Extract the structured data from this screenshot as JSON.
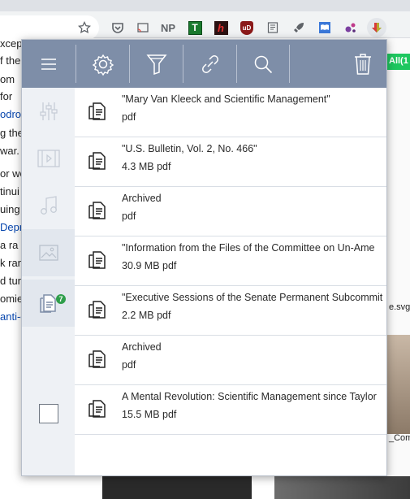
{
  "toolbar": {
    "ext_np_label": "NP",
    "ext_t_label": "T",
    "ext_h_label": "h",
    "ext_ub_label": "uD"
  },
  "background_page": {
    "left_fragments": [
      "xcep",
      "f the",
      "om",
      "for",
      "odro",
      "g the",
      "war.",
      "or wo",
      "tinui",
      "uing t",
      "Depr",
      " a ra",
      "k ran",
      "d tur",
      "omie",
      "anti-c"
    ],
    "right_tag": "All(1",
    "right_file": "e.svg",
    "right_file2": "_Com"
  },
  "popup": {
    "header_buttons": [
      "menu-icon",
      "settings-icon",
      "filter-icon",
      "link-icon",
      "search-icon",
      "trash-icon"
    ],
    "sidebar": {
      "items": [
        {
          "name": "sliders-icon",
          "active": false
        },
        {
          "name": "video-icon",
          "active": false
        },
        {
          "name": "music-icon",
          "active": false
        },
        {
          "name": "image-icon",
          "active": false
        },
        {
          "name": "documents-icon",
          "active": true,
          "badge": "7"
        },
        {
          "name": "select-all-checkbox",
          "active": false
        }
      ]
    },
    "items": [
      {
        "title": "\"Mary Van Kleeck and Scientific Management\"",
        "meta": "pdf"
      },
      {
        "title": "\"U.S. Bulletin, Vol. 2, No. 466\"",
        "meta": "4.3 MB pdf"
      },
      {
        "title": "Archived",
        "meta": "pdf"
      },
      {
        "title": "\"Information from the Files of the Committee on Un-Ame",
        "meta": "30.9 MB pdf"
      },
      {
        "title": "\"Executive Sessions of the Senate Permanent Subcommit",
        "meta": "2.2 MB pdf"
      },
      {
        "title": "Archived",
        "meta": "pdf"
      },
      {
        "title": "A Mental Revolution: Scientific Management since Taylor",
        "meta": "15.5 MB pdf"
      }
    ]
  },
  "colors": {
    "header": "#7e8ea8",
    "sidebar": "#eef1f5",
    "badge": "#2e9e4a",
    "accent_green": "#1ec75f"
  }
}
